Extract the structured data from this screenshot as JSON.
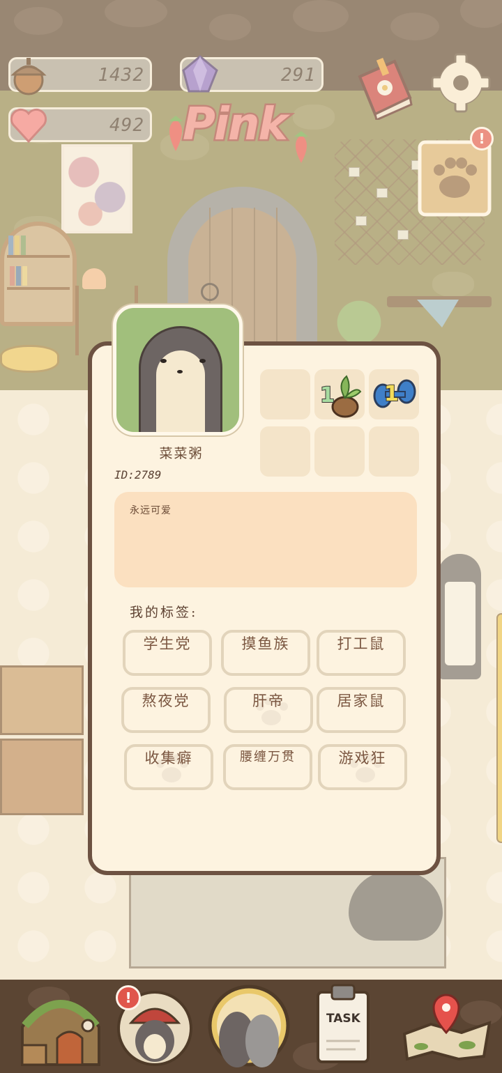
{
  "hud": {
    "acorns": "1432",
    "gems": "291",
    "hearts": "492",
    "event_logo": "Pink"
  },
  "notifications": {
    "paw_note_badge": "!",
    "character_badge": "!"
  },
  "profile": {
    "nickname": "菜菜粥",
    "id_text": "ID:2789",
    "bio": "永远可爱",
    "badge_slots": [
      "",
      "1",
      "1",
      "",
      "",
      ""
    ],
    "tags_title": "我的标签:",
    "tags": [
      "学生党",
      "摸鱼族",
      "打工鼠",
      "熬夜党",
      "肝帝",
      "居家鼠",
      "收集癖",
      "腰缠万贯",
      "游戏狂"
    ]
  },
  "nav": {
    "task_label": "TASK"
  },
  "colors": {
    "panel_bg": "#fdf3e0",
    "panel_border": "#6d5242",
    "bio_bg": "#fbe0c0",
    "badge_red": "#e0564c",
    "avatar_bg": "#a1bf7c"
  },
  "icons": [
    "acorn-icon",
    "gem-icon",
    "heart-icon",
    "book-icon",
    "gear-icon",
    "paw-note-icon",
    "home-icon",
    "character-icon",
    "otters-icon",
    "task-clipboard-icon",
    "map-icon"
  ]
}
